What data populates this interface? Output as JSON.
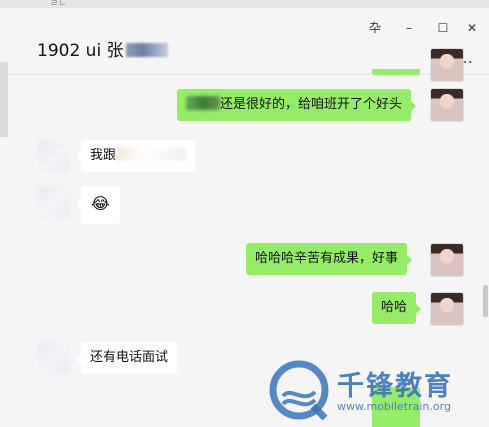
{
  "window": {
    "top_fragment": "ㄹㄴ",
    "title": "1902  ui 张",
    "controls": {
      "pin": "卆",
      "minimize": "–",
      "maximize": "☐",
      "close": "✕"
    },
    "more": "…"
  },
  "messages": [
    {
      "side": "me",
      "text_visible": "还是很好的，给咱班开了个好头"
    },
    {
      "side": "other",
      "text_visible": "我跟"
    },
    {
      "side": "other",
      "emoji": "😂"
    },
    {
      "side": "me",
      "text": "哈哈哈辛苦有成果，好事"
    },
    {
      "side": "me",
      "text": "哈哈"
    },
    {
      "side": "other",
      "text": "还有电话面试"
    }
  ],
  "watermark": {
    "brand": "千锋教育",
    "url": "www.mobiletrain.org"
  },
  "colors": {
    "bubble_me": "#95ec69",
    "bubble_other": "#ffffff",
    "bg": "#f5f5f5",
    "watermark": "#3c74b8"
  }
}
